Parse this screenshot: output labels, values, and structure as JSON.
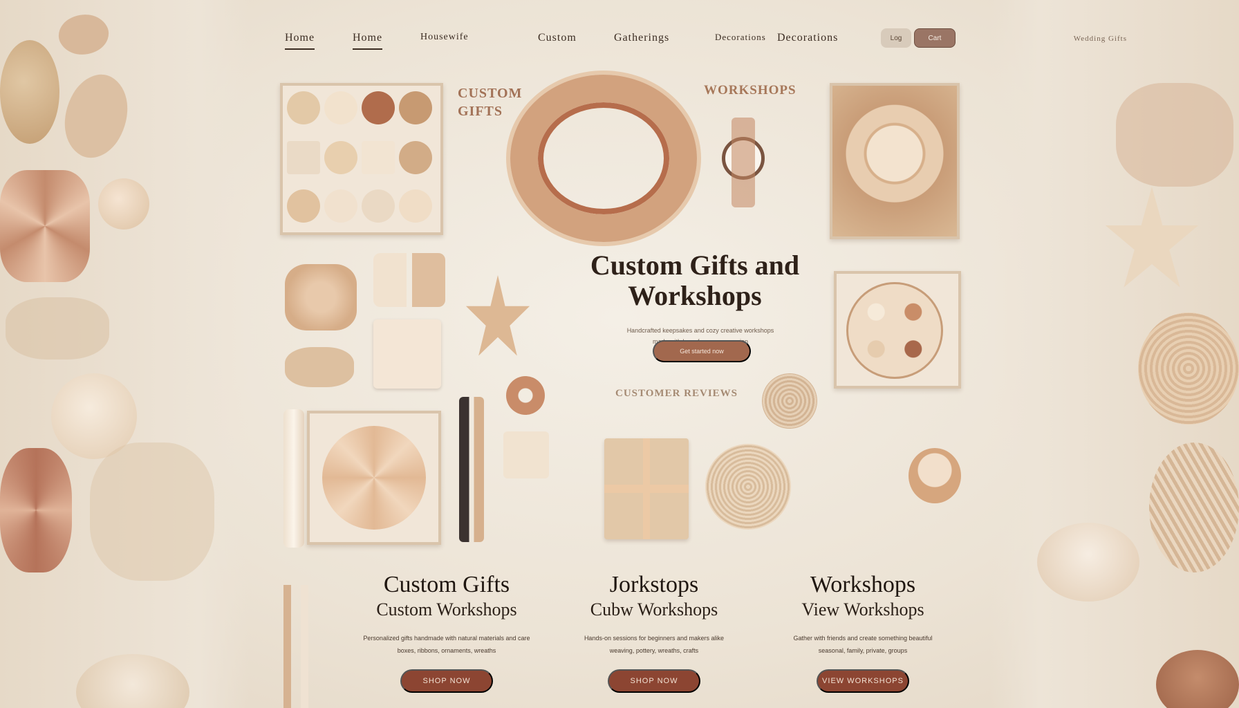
{
  "nav": {
    "items": [
      "Home",
      "Home",
      "Housewife",
      "Custom",
      "Gatherings",
      "Decorations",
      "Decorations"
    ],
    "pills": [
      "Log",
      "Cart"
    ],
    "right_text": "Wedding Gifts"
  },
  "section_labels": {
    "custom_gifts": "CUSTOM GIFTS",
    "workshops": "WORKSHOPS",
    "customer_reviews": "CUSTOMER REVIEWS"
  },
  "hero": {
    "title": "Custom Gifts and Workshops",
    "text_line1": "Handcrafted keepsakes and cozy creative workshops",
    "text_line2": "made with love, for every occasion",
    "button": "Get started now"
  },
  "cards": [
    {
      "title": "Custom Gifts",
      "subtitle": "Custom Workshops",
      "text1": "Personalized gifts handmade with natural materials and care",
      "text2": "boxes, ribbons, ornaments, wreaths",
      "button": "SHOP NOW"
    },
    {
      "title": "Jorkstops",
      "subtitle": "Cubw Workshops",
      "text1": "Hands-on sessions for beginners and makers alike",
      "text2": "weaving, pottery, wreaths, crafts",
      "button": "SHOP NOW"
    },
    {
      "title": "Workshops",
      "subtitle": "View Workshops",
      "text1": "Gather with friends and create something beautiful",
      "text2": "seasonal, family, private, groups",
      "button": "VIEW WORKSHOPS"
    }
  ],
  "colors": {
    "background": "#eee6da",
    "accent": "#8c4532",
    "hero_button": "#a2684e",
    "text_dark": "#2e2119"
  }
}
